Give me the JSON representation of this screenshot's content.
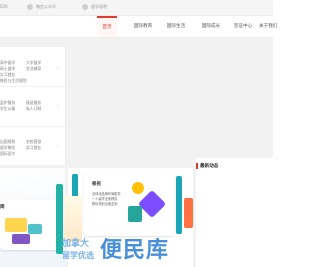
{
  "topbar": {
    "partial_left": "029",
    "wechat_label": "微信公众号",
    "mini_label": "留学说吧"
  },
  "nav": {
    "items": [
      {
        "label": "首页",
        "active": true
      },
      {
        "label": "国际教育",
        "active": false
      },
      {
        "label": "国际生活",
        "active": false
      },
      {
        "label": "国际成长",
        "active": false
      },
      {
        "label": "签证中心",
        "active": false
      },
      {
        "label": "关于我们",
        "active": false
      }
    ]
  },
  "sidebar": {
    "groups": [
      {
        "lines": [
          "高中留学",
          "大学留学",
          "硕士留学",
          "学业辅导",
          "实习就业",
          "移民与生活规划"
        ]
      },
      {
        "lines": [
          "监护服务",
          "接送服务",
          "学生公寓",
          "私人订制"
        ]
      },
      {
        "lines": [
          "出国规划",
          "名校营游",
          "留学移民",
          "实习就业",
          "国际夏令"
        ]
      }
    ]
  },
  "banner": {
    "card_left_partial": "简",
    "card_mid_title": "移民",
    "card_mid_lines": [
      "全球化品牌布局服务",
      "一人留学全家移民",
      "移民规划全面定制"
    ]
  },
  "news": {
    "title": "最新动态"
  },
  "watermark": {
    "school": "加拿大",
    "school2": "留学优选",
    "brand": "便民库"
  }
}
